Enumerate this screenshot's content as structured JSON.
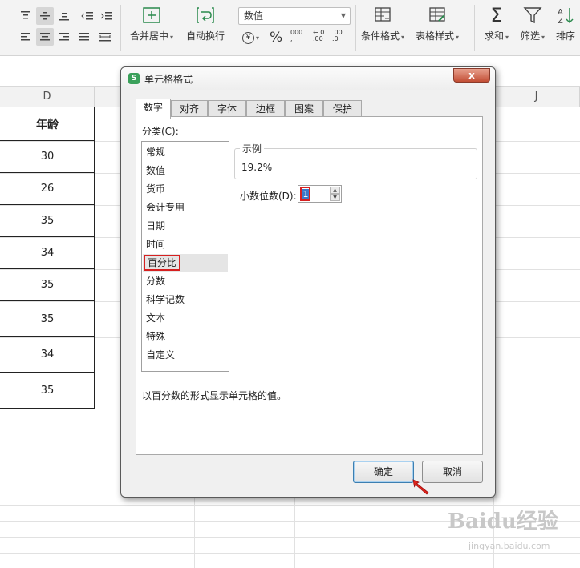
{
  "ribbon": {
    "merge_center": "合并居中",
    "wrap_text": "自动换行",
    "number_format": "数值",
    "percent_symbol": "%",
    "currency_symbol": "¥",
    "thousands_symbol": "000",
    "inc_decimal": ".00",
    "dec_decimal": ".0",
    "conditional_format": "条件格式",
    "table_style": "表格样式",
    "sum": "求和",
    "filter": "筛选",
    "sort": "排序"
  },
  "sheet": {
    "columns": [
      "D",
      "J"
    ],
    "header": "年龄",
    "ages": [
      "30",
      "26",
      "35",
      "34",
      "35",
      "35",
      "34",
      "35"
    ]
  },
  "dialog": {
    "title": "单元格格式",
    "close": "x",
    "tabs": [
      "数字",
      "对齐",
      "字体",
      "边框",
      "图案",
      "保护"
    ],
    "category_label": "分类(C):",
    "categories": [
      "常规",
      "数值",
      "货币",
      "会计专用",
      "日期",
      "时间",
      "百分比",
      "分数",
      "科学记数",
      "文本",
      "特殊",
      "自定义"
    ],
    "selected_category": "百分比",
    "sample_label": "示例",
    "sample_value": "19.2%",
    "decimals_label": "小数位数(D):",
    "decimals_value": "1",
    "description": "以百分数的形式显示单元格的值。",
    "ok": "确定",
    "cancel": "取消"
  },
  "watermark": {
    "brand": "Baidu经验",
    "url": "jingyan.baidu.com"
  },
  "colors": {
    "highlight_red": "#d62020",
    "selection_blue": "#3a78c9"
  }
}
